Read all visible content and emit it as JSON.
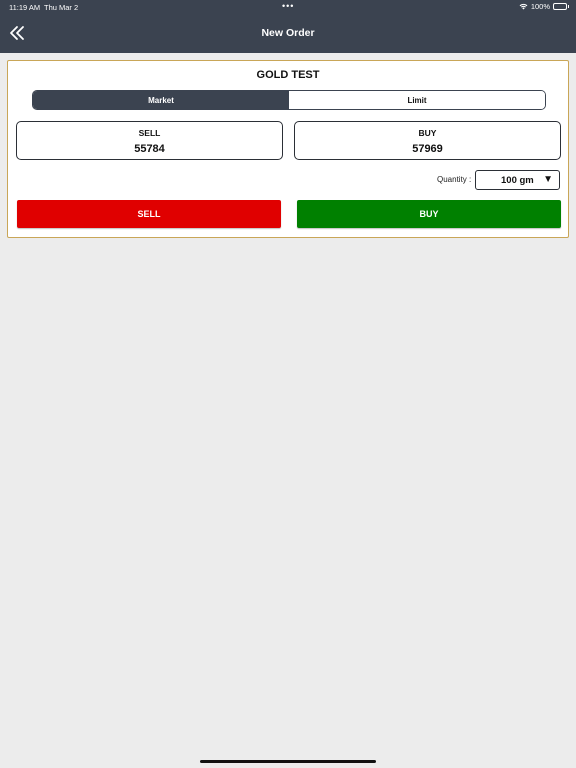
{
  "status_bar": {
    "time": "11:19 AM",
    "date": "Thu Mar 2",
    "dots": "•••",
    "battery": "100%",
    "icons": [
      "wifi-icon",
      "battery-icon"
    ]
  },
  "nav": {
    "title": "New Order",
    "back_icon": "double-chevron-left-icon"
  },
  "order": {
    "instrument": "GOLD TEST",
    "order_types": [
      {
        "label": "Market",
        "active": true
      },
      {
        "label": "Limit",
        "active": false
      }
    ],
    "sell": {
      "label": "SELL",
      "price": "55784"
    },
    "buy": {
      "label": "BUY",
      "price": "57969"
    },
    "quantity": {
      "label": "Quantity :",
      "value": "100 gm",
      "dropdown_icon": "▼"
    },
    "buttons": {
      "sell": "SELL",
      "buy": "BUY"
    }
  },
  "colors": {
    "header": "#3b4350",
    "sell": "#e00000",
    "buy": "#008000",
    "card_border": "#c9a657"
  }
}
